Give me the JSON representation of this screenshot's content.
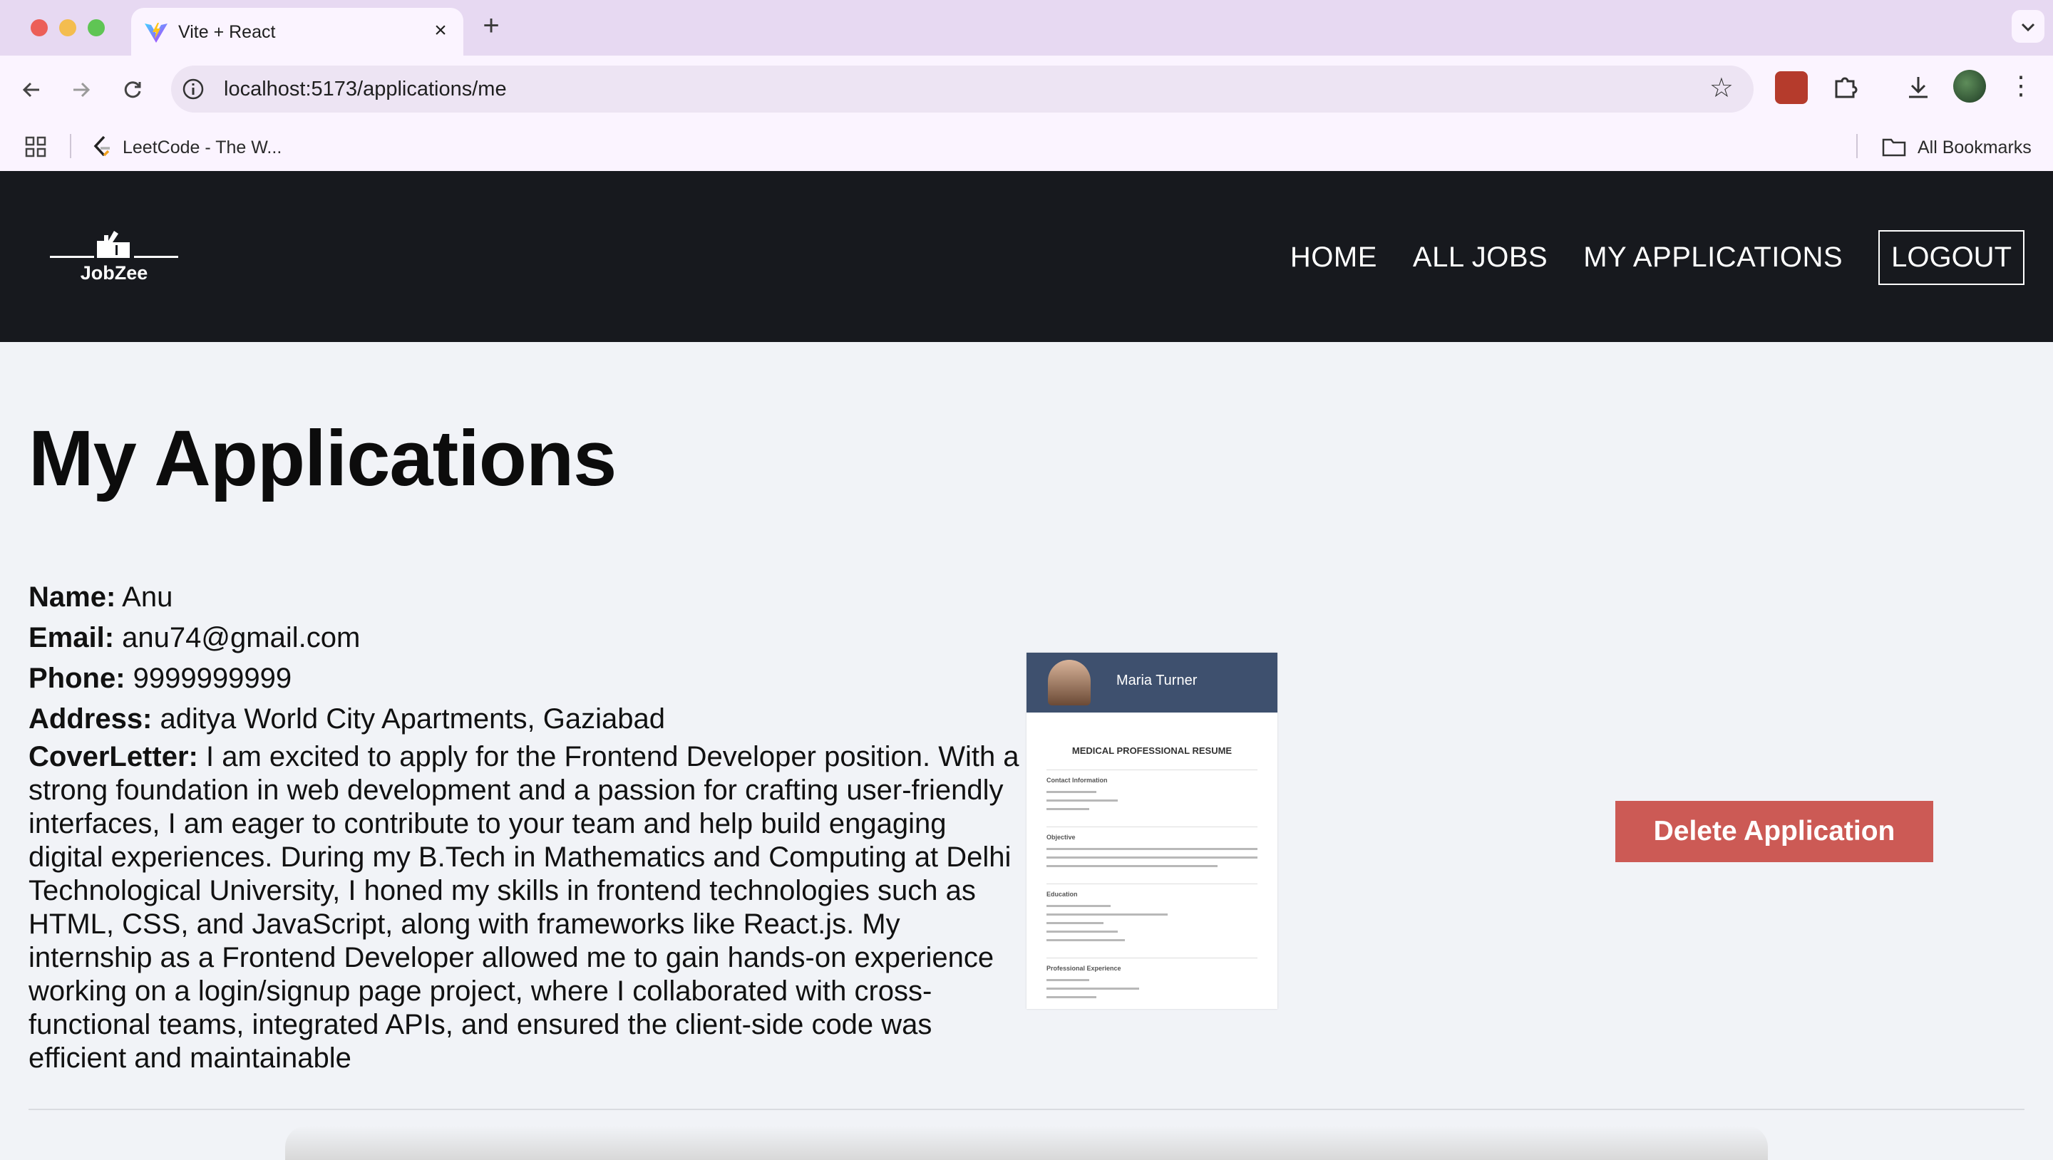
{
  "browser": {
    "tab_title": "Vite + React",
    "tab_close": "×",
    "new_tab": "+",
    "url": "localhost:5173/applications/me",
    "bookmarks": [
      {
        "label": "LeetCode - The W..."
      }
    ],
    "all_bookmarks": "All Bookmarks"
  },
  "site": {
    "logo_text": "JobZee",
    "nav": {
      "home": "HOME",
      "all_jobs": "ALL JOBS",
      "my_applications": "MY APPLICATIONS",
      "logout": "LOGOUT"
    }
  },
  "page": {
    "title": "My Applications"
  },
  "application": {
    "name_label": "Name:",
    "name": "Anu",
    "email_label": "Email:",
    "email": "anu74@gmail.com",
    "phone_label": "Phone:",
    "phone": "9999999999",
    "address_label": "Address:",
    "address": "aditya World City Apartments, Gaziabad",
    "cover_label": "CoverLetter:",
    "cover_letter": "I am excited to apply for the Frontend Developer position. With a strong foundation in web development and a passion for crafting user-friendly interfaces, I am eager to contribute to your team and help build engaging digital experiences. During my B.Tech in Mathematics and Computing at Delhi Technological University, I honed my skills in frontend technologies such as HTML, CSS, and JavaScript, along with frameworks like React.js. My internship as a Frontend Developer allowed me to gain hands-on experience working on a login/signup page project, where I collaborated with cross-functional teams, integrated APIs, and ensured the client-side code was efficient and maintainable",
    "resume": {
      "name": "Maria Turner",
      "title": "MEDICAL PROFESSIONAL RESUME",
      "sections": [
        "Contact Information",
        "Objective",
        "Education",
        "Professional Experience"
      ]
    },
    "delete_label": "Delete Application"
  },
  "colors": {
    "nav_bg": "#17191e",
    "page_bg": "#f1f3f7",
    "delete_btn": "#cc5a55",
    "tabbar": "#e7d9f2",
    "toolbar": "#fbf4ff"
  },
  "icons": [
    "vite-icon",
    "close-icon",
    "plus-icon",
    "chevron-down-icon",
    "back-arrow-icon",
    "forward-arrow-icon",
    "reload-icon",
    "info-icon",
    "star-icon",
    "extension-icon",
    "puzzle-icon",
    "download-icon",
    "profile-avatar",
    "kebab-menu-icon",
    "apps-grid-icon",
    "leetcode-icon",
    "folder-icon"
  ]
}
